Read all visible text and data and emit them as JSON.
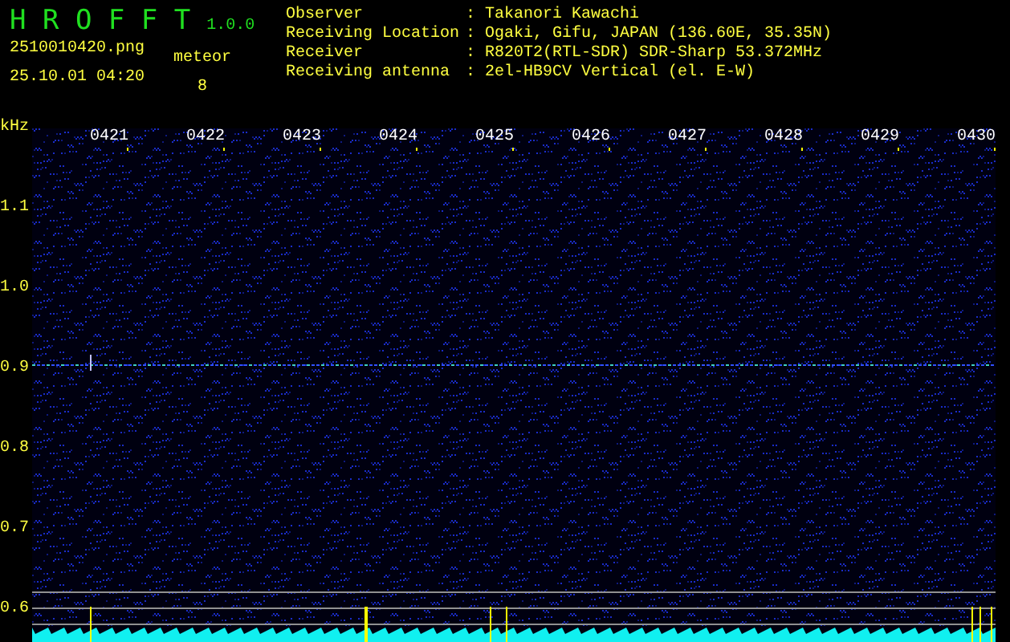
{
  "app": {
    "title": "H R O F F T",
    "version": "1.0.0"
  },
  "file": {
    "name": "2510010420.png",
    "datetime": "25.10.01 04:20"
  },
  "counter": {
    "label": "meteor",
    "value": "8"
  },
  "station": [
    {
      "label": "Observer",
      "value": ": Takanori Kawachi"
    },
    {
      "label": "Receiving Location",
      "value": ": Ogaki, Gifu, JAPAN (136.60E, 35.35N)"
    },
    {
      "label": "Receiver",
      "value": ": R820T2(RTL-SDR) SDR-Sharp 53.372MHz"
    },
    {
      "label": "Receiving antenna",
      "value": ": 2el-HB9CV Vertical (el. E-W)"
    }
  ],
  "spectrogram": {
    "unit": "kHz",
    "time_labels": [
      "0421",
      "0422",
      "0423",
      "0424",
      "0425",
      "0426",
      "0427",
      "0428",
      "0429",
      "0430"
    ],
    "frequency_labels": [
      "1.1",
      "1.0",
      "0.9",
      "0.8",
      "0.7",
      "0.6"
    ]
  }
}
